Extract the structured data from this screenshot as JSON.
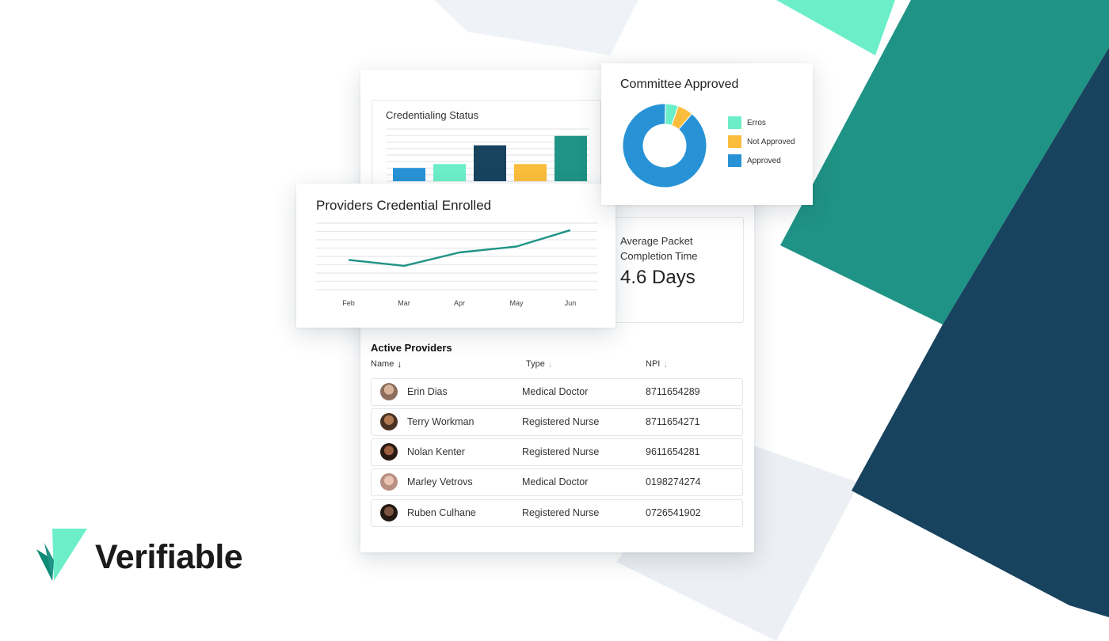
{
  "brand": {
    "name": "Verifiable",
    "colors": {
      "mint": "#6cefc9",
      "teal": "#1f9385",
      "navy": "#17435f",
      "blue": "#2793d6",
      "yellow": "#fbbd3c"
    }
  },
  "credentialing_status": {
    "title": "Credentialing Status",
    "chart_data": {
      "type": "bar",
      "title": "Credentialing Status",
      "categories": [
        "",
        "",
        "",
        "",
        ""
      ],
      "values": [
        17,
        22,
        46,
        22,
        58
      ],
      "colors": [
        "#2793d6",
        "#6cefc9",
        "#17435f",
        "#fbbd3c",
        "#1f9385"
      ],
      "ylim": [
        0,
        75
      ],
      "grid": true
    }
  },
  "committee_approved": {
    "title": "Committee Approved",
    "chart_data": {
      "type": "pie",
      "title": "Committee Approved",
      "labels": [
        "Erros",
        "Not Approved",
        "Approved"
      ],
      "values": [
        5,
        6,
        89
      ],
      "colors": [
        "#6cefc9",
        "#fbbd3c",
        "#2793d6"
      ],
      "legend": "right"
    }
  },
  "providers_enrolled": {
    "title": "Providers Credential Enrolled",
    "chart_data": {
      "type": "line",
      "title": "Providers Credential Enrolled",
      "x": [
        "Feb",
        "Mar",
        "Apr",
        "May",
        "Jun"
      ],
      "series": [
        {
          "values": [
            40,
            32,
            50,
            58,
            80
          ],
          "color": "#1f9385"
        }
      ],
      "ylim": [
        0,
        100
      ],
      "grid": true
    }
  },
  "kpi": {
    "label": "Average Packet Completion Time",
    "value": "4.6 Days"
  },
  "active_providers": {
    "title": "Active Providers",
    "columns": [
      "Name",
      "Type",
      "NPI"
    ],
    "rows": [
      {
        "name": "Erin Dias",
        "type": "Medical Doctor",
        "npi": "8711654289"
      },
      {
        "name": "Terry Workman",
        "type": "Registered Nurse",
        "npi": "8711654271"
      },
      {
        "name": "Nolan Kenter",
        "type": "Registered Nurse",
        "npi": "9611654281"
      },
      {
        "name": "Marley Vetrovs",
        "type": "Medical Doctor",
        "npi": "0198274274"
      },
      {
        "name": "Ruben Culhane",
        "type": "Registered Nurse",
        "npi": "0726541902"
      }
    ]
  }
}
